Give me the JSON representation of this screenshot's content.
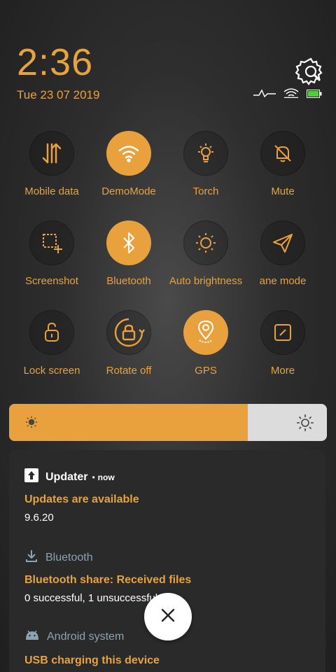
{
  "header": {
    "time": "2:36",
    "date": "Tue 23 07 2019"
  },
  "tiles": [
    {
      "label": "Mobile data",
      "icon": "mobile-data-icon",
      "active": false
    },
    {
      "label": "DemoMode",
      "icon": "wifi-icon",
      "active": true
    },
    {
      "label": "Torch",
      "icon": "torch-icon",
      "active": false
    },
    {
      "label": "Mute",
      "icon": "mute-icon",
      "active": false
    },
    {
      "label": "Screenshot",
      "icon": "screenshot-icon",
      "active": false
    },
    {
      "label": "Bluetooth",
      "icon": "bluetooth-icon",
      "active": true
    },
    {
      "label": "Auto brightness",
      "icon": "auto-brightness-icon",
      "active": false
    },
    {
      "label": "ane mode",
      "icon": "airplane-icon",
      "active": false
    },
    {
      "label": "Lock screen",
      "icon": "lock-screen-icon",
      "active": false
    },
    {
      "label": "Rotate off",
      "icon": "rotate-icon",
      "active": false
    },
    {
      "label": "GPS",
      "icon": "gps-icon",
      "active": true
    },
    {
      "label": "More",
      "icon": "more-icon",
      "active": false
    }
  ],
  "brightness": {
    "level": 0.75
  },
  "notifications": {
    "updater": {
      "app": "Updater",
      "time": "now",
      "title": "Updates are available",
      "text": "9.6.20"
    },
    "bluetooth": {
      "app": "Bluetooth",
      "title": "Bluetooth share: Received files",
      "text": "0 successful, 1 unsuccessful"
    },
    "android": {
      "app": "Android system",
      "title": "USB charging this device"
    }
  },
  "colors": {
    "accent": "#e9a13d",
    "panel": "#2a2a2a",
    "muted_app": "#8aa4b4"
  }
}
